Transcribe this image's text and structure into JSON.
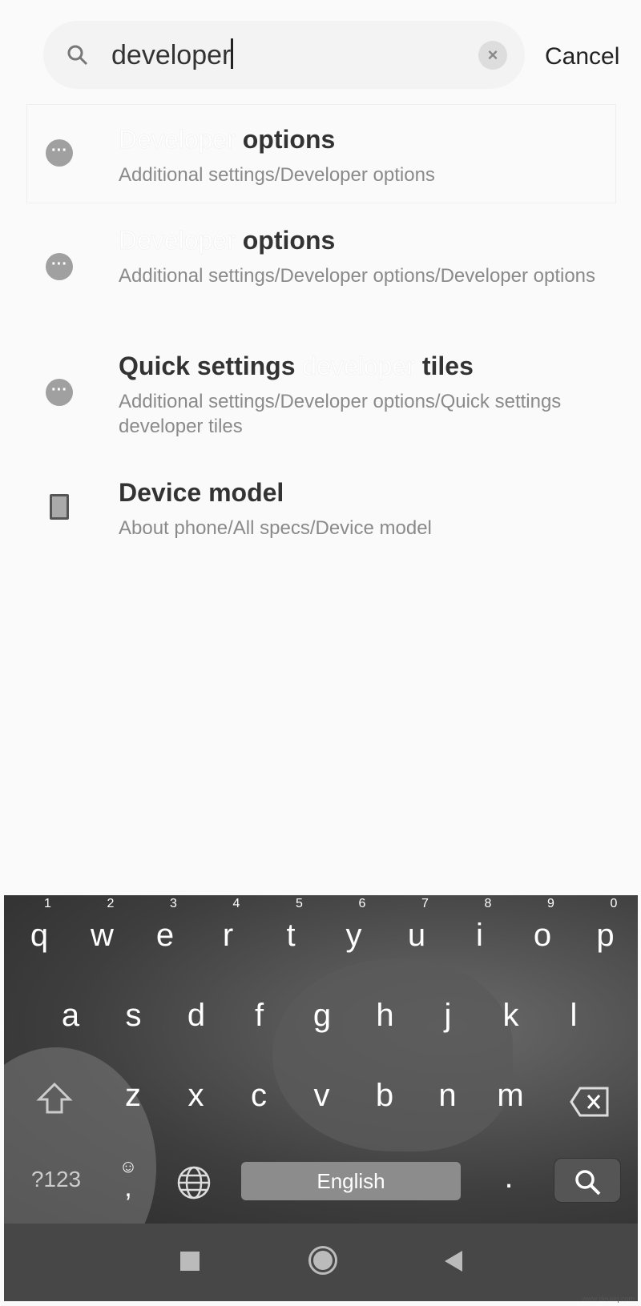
{
  "search": {
    "value": "developer",
    "cancel_label": "Cancel"
  },
  "results": [
    {
      "title_highlight": "Developer",
      "title_rest": " options",
      "path": "Additional settings/Developer options"
    },
    {
      "title_highlight": "Developer",
      "title_rest": " options",
      "path": "Additional settings/Developer options/Developer options"
    },
    {
      "title_before": "Quick settings ",
      "title_highlight": "developer",
      "title_rest": " tiles",
      "path": "Additional settings/Developer options/Quick settings developer tiles"
    },
    {
      "title": "Device model",
      "path": "About phone/All specs/Device model"
    }
  ],
  "keyboard": {
    "row1": [
      "q",
      "w",
      "e",
      "r",
      "t",
      "y",
      "u",
      "i",
      "o",
      "p"
    ],
    "row1_nums": [
      "1",
      "2",
      "3",
      "4",
      "5",
      "6",
      "7",
      "8",
      "9",
      "0"
    ],
    "row2": [
      "a",
      "s",
      "d",
      "f",
      "g",
      "h",
      "j",
      "k",
      "l"
    ],
    "row3": [
      "z",
      "x",
      "c",
      "v",
      "b",
      "n",
      "m"
    ],
    "symbols_label": "?123",
    "comma": ",",
    "period": ".",
    "space_label": "English"
  },
  "watermark": "www.deuaq.com"
}
